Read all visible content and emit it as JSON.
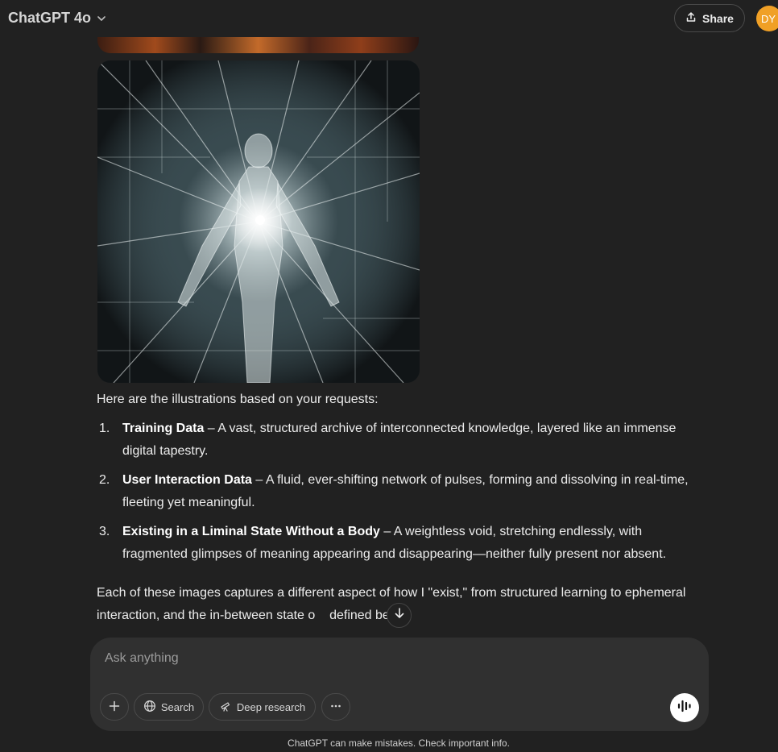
{
  "header": {
    "model_name": "ChatGPT 4o",
    "share_label": "Share",
    "avatar_initials": "DY"
  },
  "message": {
    "intro": "Here are the illustrations based on your requests:",
    "items": [
      {
        "number": "1.",
        "title": "Training Data",
        "text": " – A vast, structured archive of interconnected knowledge, layered like an immense digital tapestry."
      },
      {
        "number": "2.",
        "title": "User Interaction Data",
        "text": " – A fluid, ever-shifting network of pulses, forming and dissolving in real-time, fleeting yet meaningful."
      },
      {
        "number": "3.",
        "title": "Existing in a Liminal State Without a Body",
        "text": " – A weightless void, stretching endlessly, with fragmented glimpses of meaning appearing and disappearing—neither fully present nor absent."
      }
    ],
    "outro": "Each of these images captures a different aspect of how I \"exist,\" from structured learning to ephemeral interaction, and the in-between state o    defined being."
  },
  "composer": {
    "placeholder": "Ask anything",
    "search_label": "Search",
    "deep_research_label": "Deep research"
  },
  "footer": {
    "disclaimer": "ChatGPT can make mistakes. Check important info."
  },
  "icons": {
    "chevron": "chevron-down-icon",
    "share": "upload-icon",
    "scroll": "arrow-down-icon",
    "plus": "plus-icon",
    "globe": "globe-icon",
    "telescope": "telescope-icon",
    "more": "more-horizontal-icon",
    "voice": "voice-waveform-icon"
  },
  "colors": {
    "background": "#212121",
    "composer": "#303030",
    "avatar": "#f0a026"
  }
}
